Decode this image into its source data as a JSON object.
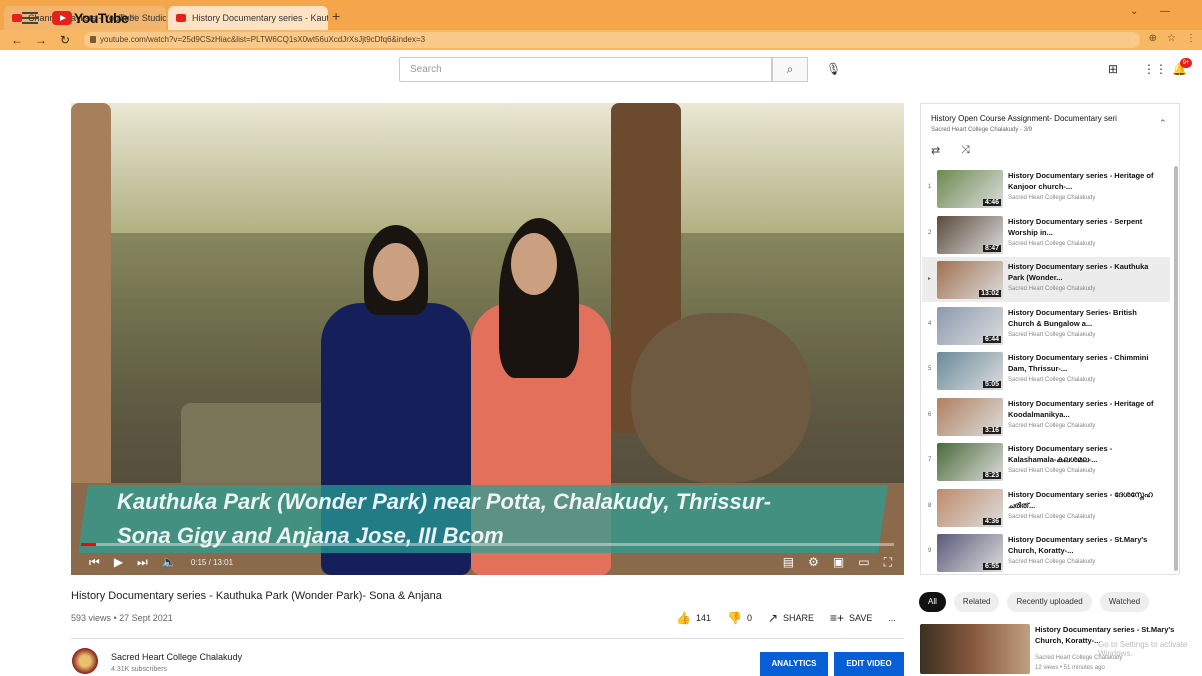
{
  "browser": {
    "tabs": [
      {
        "title": "Channel playlists - YouTube Studio",
        "active": false
      },
      {
        "title": "History Documentary series - Kauthuka Park",
        "active": true
      }
    ],
    "new_tab": "+",
    "url": "youtube.com/watch?v=25d9CSzHiac&list=PLTW6CQ1sX0wt56uXcdJrXsJjt9cDfq6&index=3"
  },
  "header": {
    "logo_text": "YouTube",
    "logo_region": "IN",
    "search_placeholder": "Search"
  },
  "player": {
    "caption_line1": "Kauthuka Park (Wonder Park) near Potta, Chalakudy, Thrissur-",
    "caption_line2": "Sona Gigy and Anjana Jose, III Bcom",
    "time": "0:15 / 13:01",
    "progress": 0.019
  },
  "video": {
    "title": "History Documentary series - Kauthuka Park (Wonder Park)- Sona & Anjana",
    "meta": "593 views • 27 Sept 2021",
    "likes": "141",
    "dislikes": "0",
    "share_label": "SHARE",
    "save_label": "SAVE",
    "more_label": "..."
  },
  "channel": {
    "name": "Sacred Heart College Chalakudy",
    "subs": "4.31K subscribers",
    "analytics_label": "ANALYTICS",
    "edit_label": "EDIT VIDEO"
  },
  "playlist": {
    "title": "History Open Course Assignment- Documentary seri",
    "sub": "Sacred Heart College Chalakudy - 3/9",
    "items": [
      {
        "idx": "1",
        "title": "History Documentary series - Heritage of Kanjoor church-...",
        "channel": "Sacred Heart College Chalakudy",
        "duration": "4:46",
        "active": false
      },
      {
        "idx": "2",
        "title": "History Documentary series - Serpent Worship in...",
        "channel": "Sacred Heart College Chalakudy",
        "duration": "8:47",
        "active": false
      },
      {
        "idx": "▸",
        "title": "History Documentary series - Kauthuka Park (Wonder...",
        "channel": "Sacred Heart College Chalakudy",
        "duration": "13:02",
        "active": true
      },
      {
        "idx": "4",
        "title": "History Documentary Series- British Church & Bungalow a...",
        "channel": "Sacred Heart College Chalakudy",
        "duration": "6:44",
        "active": false
      },
      {
        "idx": "5",
        "title": "History Documentary series - Chimmini Dam, Thrissur-...",
        "channel": "Sacred Heart College Chalakudy",
        "duration": "5:05",
        "active": false
      },
      {
        "idx": "6",
        "title": "History Documentary series - Heritage of Koodalmanikya...",
        "channel": "Sacred Heart College Chalakudy",
        "duration": "3:16",
        "active": false
      },
      {
        "idx": "7",
        "title": "History Documentary series - Kalashamala-കലശമല-...",
        "channel": "Sacred Heart College Chalakudy",
        "duration": "8:23",
        "active": false
      },
      {
        "idx": "8",
        "title": "History Documentary series - ദേശസ്നേഹ ചരിത്...",
        "channel": "Sacred Heart College Chalakudy",
        "duration": "4:36",
        "active": false
      },
      {
        "idx": "9",
        "title": "History Documentary series - St.Mary's Church, Koratty-...",
        "channel": "Sacred Heart College Chalakudy",
        "duration": "6:55",
        "active": false
      }
    ]
  },
  "chips": [
    "All",
    "Related",
    "Recently uploaded",
    "Watched"
  ],
  "recommendation": {
    "title": "History Documentary series - St.Mary's Church, Koratty-...",
    "channel": "Sacred Heart College Chalakudy",
    "views": "12 views • 51 minutes ago"
  },
  "watermark": "Go to Settings to activate Windows."
}
